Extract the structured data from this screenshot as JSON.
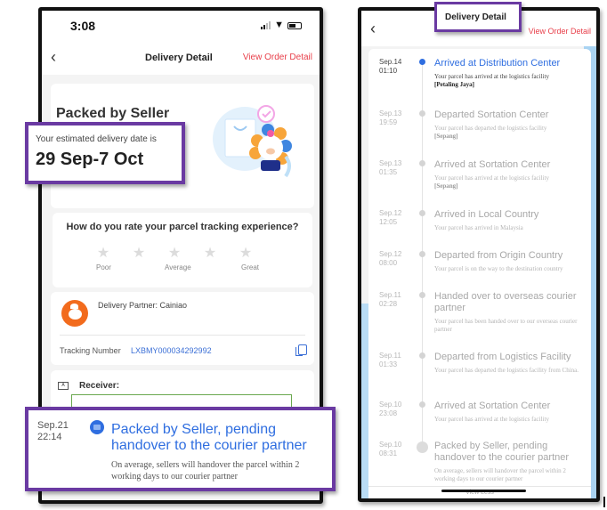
{
  "left_phone": {
    "status_bar": {
      "time": "3:08",
      "icons": [
        "signal-icon",
        "wifi-icon",
        "battery-icon"
      ]
    },
    "nav": {
      "back_icon": "chevron-left",
      "title": "Delivery Detail",
      "link": "View Order Detail"
    },
    "status_card": {
      "title": "Packed by Seller"
    },
    "estimate": {
      "label": "Your estimated delivery date is",
      "date": "29 Sep-7 Oct"
    },
    "rating": {
      "question": "How do you rate your parcel tracking experience?",
      "stars_total": 5,
      "stars_selected": 0,
      "labels": [
        "Poor",
        "Average",
        "Great"
      ]
    },
    "partner": {
      "label": "Delivery Partner: Cainiao",
      "tracking_label": "Tracking Number",
      "tracking_number": "LXBMY000034292992"
    },
    "receiver": {
      "label": "Receiver:"
    },
    "latest_event": {
      "date": "Sep.21",
      "time": "22:14",
      "title": "Packed by Seller, pending handover to the courier partner",
      "description": "On average, sellers will handover the parcel within 2 working days to our courier partner"
    }
  },
  "right_phone": {
    "nav": {
      "back_icon": "chevron-left",
      "title": "Delivery Detail",
      "link": "View Order Detail"
    },
    "timeline": [
      {
        "date": "Sep.14",
        "time": "01:10",
        "title": "Arrived at Distribution Center",
        "desc": "Your parcel has arrived at the logistics facility",
        "place": "[Petaling Jaya]",
        "active": true
      },
      {
        "date": "Sep.13",
        "time": "19:59",
        "title": "Departed Sortation Center",
        "desc": "Your parcel has departed the logistics facility",
        "place": "[Sepang]"
      },
      {
        "date": "Sep.13",
        "time": "01:35",
        "title": "Arrived at Sortation Center",
        "desc": "Your parcel has arrived at the logistics facility",
        "place": "[Sepang]"
      },
      {
        "date": "Sep.12",
        "time": "12:05",
        "title": "Arrived in Local Country",
        "desc": "Your parcel has arrived in Malaysia",
        "place": ""
      },
      {
        "date": "Sep.12",
        "time": "08:00",
        "title": "Departed from Origin Country",
        "desc": "Your parcel is on the way to the destination country",
        "place": ""
      },
      {
        "date": "Sep.11",
        "time": "02:28",
        "title": "Handed over to overseas courier partner",
        "desc": "Your parcel has been handed over to our overseas courier partner",
        "place": ""
      },
      {
        "date": "Sep.11",
        "time": "01:33",
        "title": "Departed from Logistics Facility",
        "desc": "Your parcel has departed the logistics facility from China.",
        "place": ""
      },
      {
        "date": "Sep.10",
        "time": "23:08",
        "title": "Arrived at Sortation Center",
        "desc": "Your parcel has arrived at the logistics facility",
        "place": ""
      },
      {
        "date": "Sep.10",
        "time": "08:31",
        "title": "Packed by Seller, pending handover to the courier partner",
        "desc": "On average, sellers will handover the parcel within 2 working days to our courier partner",
        "place": ""
      }
    ],
    "view_less": "View Less"
  },
  "colors": {
    "accent_blue": "#2f6ee0",
    "link_red": "#e8404b",
    "callout_purple": "#6a3aa2",
    "redaction_green": "#6aa84f"
  }
}
